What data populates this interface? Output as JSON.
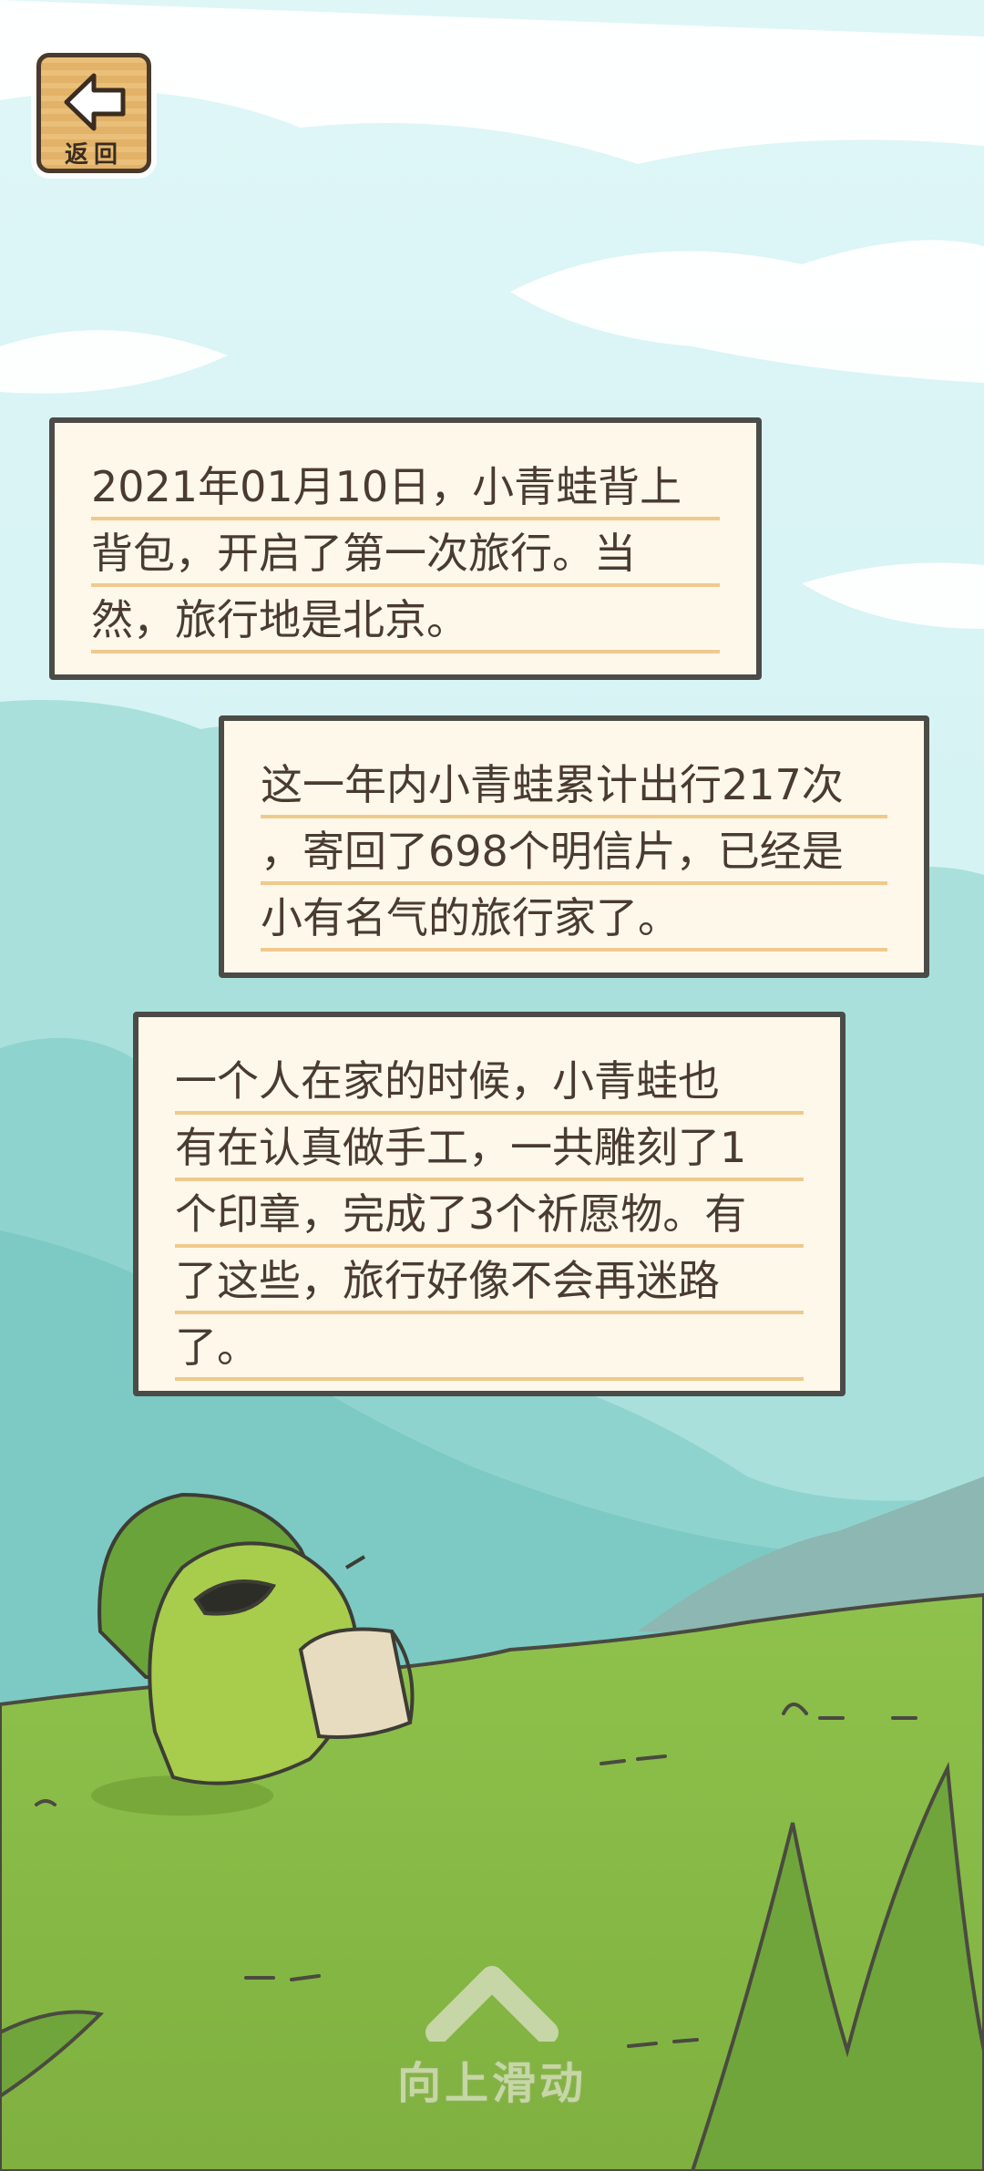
{
  "header": {
    "back_label": "返回"
  },
  "notes": [
    {
      "lines": [
        "2021年01月10日，小青蛙背上",
        "背包，开启了第一次旅行。当",
        "然，旅行地是北京。"
      ]
    },
    {
      "lines": [
        "这一年内小青蛙累计出行217次",
        "，寄回了698个明信片，已经是",
        "小有名气的旅行家了。"
      ]
    },
    {
      "lines": [
        "一个人在家的时候，小青蛙也",
        "有在认真做手工，一共雕刻了1",
        "个印章，完成了3个祈愿物。有",
        "了这些，旅行好像不会再迷路",
        "了。"
      ]
    }
  ],
  "footer": {
    "swipe_label": "向上滑动"
  },
  "colors": {
    "sky": "#d6f2f4",
    "mountain": "#8fd3cf",
    "grass": "#8cbd4a",
    "note_bg": "#fdf8ea",
    "note_line": "#f0c98d",
    "frog": "#a3c74a"
  }
}
